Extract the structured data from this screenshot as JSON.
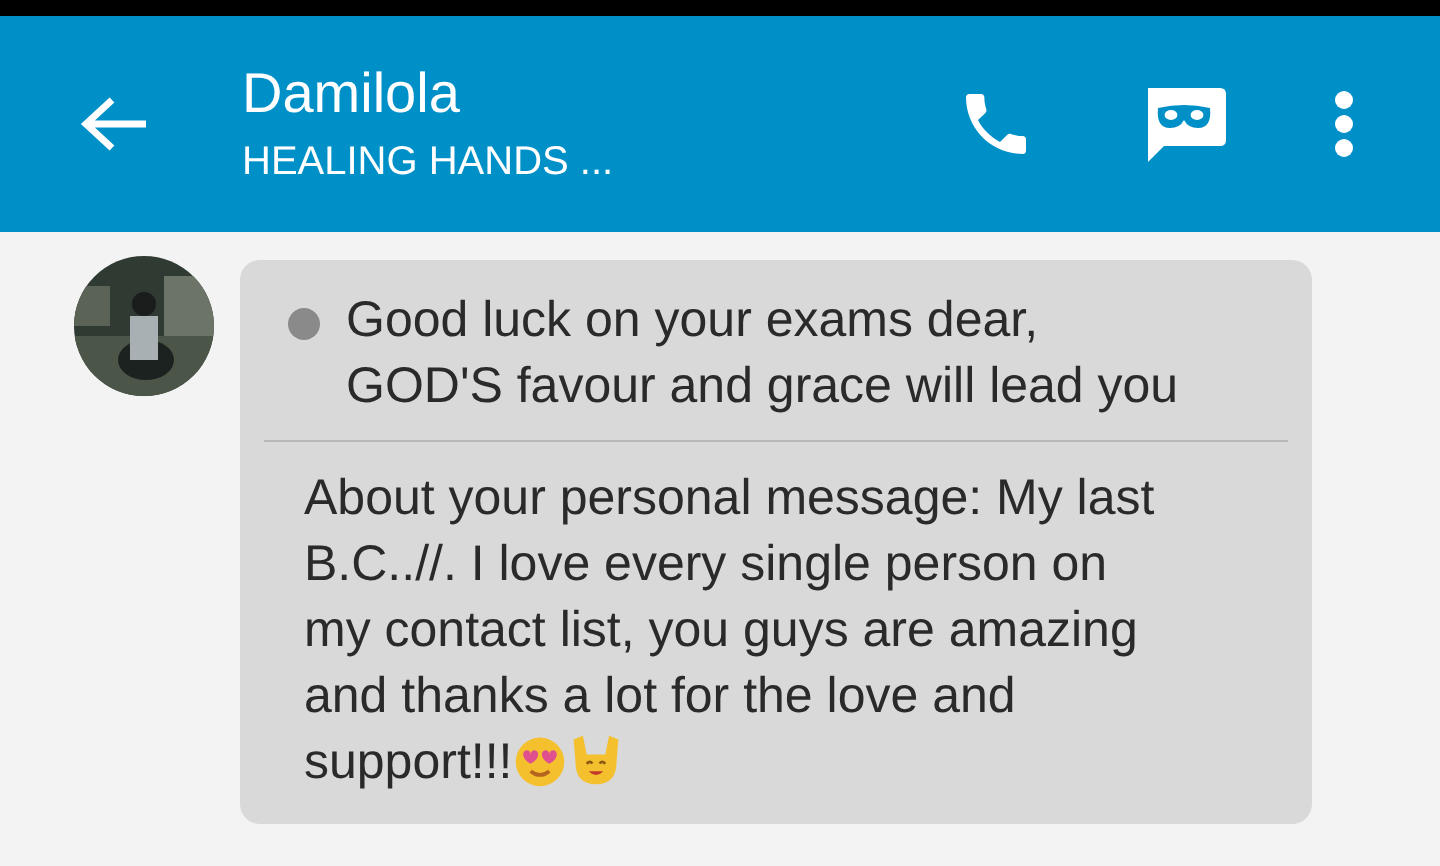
{
  "header": {
    "title": "Damilola",
    "subtitle": "HEALING HANDS ..."
  },
  "messages": [
    {
      "parts": [
        {
          "kind": "status",
          "text": "Good luck on your exams dear,\nGOD'S favour and grace will lead you"
        },
        {
          "kind": "body",
          "text": "About your personal message: My last\nB.C..//. I love every single person on\nmy contact list, you guys are amazing\nand thanks a lot for the love and\nsupport!!!",
          "emoji": [
            {
              "kind": "heart-eyes"
            },
            {
              "kind": "raised-hands"
            }
          ]
        }
      ]
    }
  ]
}
